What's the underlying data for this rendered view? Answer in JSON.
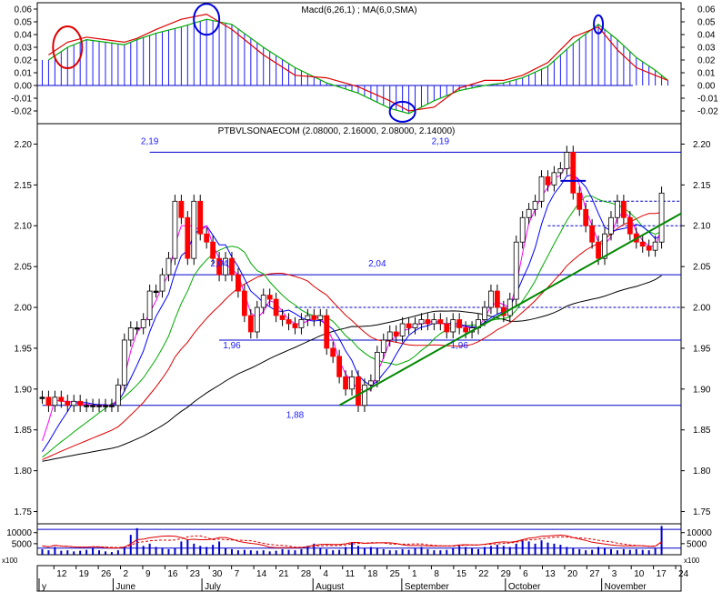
{
  "chart_data": [
    {
      "panel": "macd",
      "type": "line",
      "title": "Macd(6,26,1) ; MA(6,0,SMA)",
      "ylim": [
        -0.03,
        0.065
      ],
      "yticks": [
        "0.06",
        "0.05",
        "0.04",
        "0.03",
        "0.02",
        "0.01",
        "0.00",
        "-0.01",
        "-0.02"
      ],
      "series": [
        {
          "x": [
            1,
            4,
            7,
            10,
            13,
            15,
            18,
            22,
            26,
            30,
            35,
            40,
            45,
            50,
            55,
            58,
            62,
            66,
            70,
            73,
            76,
            80,
            84,
            88,
            91,
            94,
            97,
            99
          ],
          "values": [
            0.02,
            0.03,
            0.036,
            0.034,
            0.032,
            0.036,
            0.041,
            0.046,
            0.052,
            0.048,
            0.03,
            0.014,
            0.002,
            -0.006,
            -0.018,
            -0.022,
            -0.012,
            -0.004,
            0.0,
            0.002,
            0.006,
            0.015,
            0.033,
            0.048,
            0.036,
            0.022,
            0.012,
            0.004
          ]
        },
        {
          "x": [
            1,
            4,
            7,
            10,
            13,
            15,
            18,
            22,
            26,
            30,
            35,
            40,
            45,
            50,
            55,
            58,
            62,
            66,
            70,
            73,
            76,
            80,
            84,
            88,
            91,
            94,
            97,
            99
          ],
          "values": [
            0.024,
            0.034,
            0.038,
            0.036,
            0.034,
            0.037,
            0.044,
            0.052,
            0.056,
            0.044,
            0.024,
            0.008,
            0.006,
            -0.001,
            -0.012,
            -0.02,
            -0.017,
            -0.002,
            0.004,
            0.004,
            0.008,
            0.018,
            0.038,
            0.046,
            0.028,
            0.014,
            0.008,
            0.004
          ]
        }
      ],
      "markers": [
        "red",
        "blue",
        "blue",
        "blue"
      ]
    },
    {
      "panel": "price",
      "type": "candlestick",
      "title": "PTBVLSONAECOM (2.08000, 2.16000, 2.08000, 2.14000)",
      "ylim": [
        1.735,
        2.225
      ],
      "yticks": [
        "2.20",
        "2.15",
        "2.10",
        "2.05",
        "2.00",
        "1.95",
        "1.90",
        "1.85",
        "1.80",
        "1.75"
      ],
      "x_range": [
        0,
        104
      ],
      "close": [
        1.89,
        1.88,
        1.89,
        1.885,
        1.88,
        1.885,
        1.88,
        1.88,
        1.88,
        1.88,
        1.88,
        1.88,
        1.905,
        1.96,
        1.975,
        1.975,
        1.985,
        2.02,
        2.02,
        2.04,
        2.06,
        2.13,
        2.11,
        2.06,
        2.13,
        2.09,
        2.08,
        2.06,
        2.04,
        2.06,
        2.04,
        2.02,
        1.99,
        1.97,
        2.0,
        2.015,
        2.01,
        1.99,
        1.985,
        1.98,
        1.975,
        1.985,
        1.99,
        1.985,
        1.99,
        1.95,
        1.94,
        1.915,
        1.9,
        1.915,
        1.88,
        1.905,
        1.91,
        1.945,
        1.96,
        1.97,
        1.965,
        1.98,
        1.975,
        1.98,
        1.985,
        1.98,
        1.985,
        1.98,
        1.97,
        1.985,
        1.975,
        1.97,
        1.975,
        1.985,
        2.0,
        2.02,
        2.0,
        1.99,
        2.01,
        2.08,
        2.11,
        2.12,
        2.13,
        2.16,
        2.15,
        2.165,
        2.17,
        2.19,
        2.14,
        2.12,
        2.1,
        2.08,
        2.06,
        2.09,
        2.11,
        2.13,
        2.11,
        2.09,
        2.08,
        2.075,
        2.07,
        2.08,
        2.14
      ]
    },
    {
      "panel": "volume",
      "type": "bar",
      "yticks": [
        "10000",
        "5000"
      ],
      "unit_label": "x100",
      "ylim": [
        0,
        14000
      ],
      "values": [
        2500,
        2000,
        3500,
        1800,
        2000,
        1500,
        1800,
        2200,
        3000,
        2000,
        1500,
        1200,
        2000,
        3500,
        9000,
        12000,
        4000,
        5000,
        3500,
        3000,
        2500,
        3000,
        6000,
        7000,
        5000,
        4000,
        3500,
        4500,
        6000,
        3000,
        2500,
        2000,
        2200,
        2000,
        1800,
        2000,
        1500,
        1800,
        2500,
        2200,
        2000,
        2500,
        4000,
        5000,
        3000,
        2500,
        2000,
        2200,
        3500,
        5500,
        4000,
        3000,
        3500,
        3000,
        2500,
        2000,
        2000,
        2500,
        2200,
        3000,
        3500,
        2500,
        2000,
        2000,
        2200,
        3000,
        4000,
        3500,
        3000,
        2500,
        3500,
        4000,
        4500,
        4000,
        3500,
        5000,
        7000,
        6000,
        5000,
        6500,
        5500,
        5000,
        4500,
        3500,
        3000,
        2500,
        2000,
        2200,
        3500,
        3000,
        2500,
        2000,
        2500,
        2200,
        2500,
        2200,
        2000,
        3000,
        13000
      ]
    }
  ],
  "price_levels": {
    "solid": [
      {
        "value": 2.19
      },
      {
        "value": 2.04
      },
      {
        "value": 1.96
      },
      {
        "value": 1.88
      }
    ],
    "dashed": [
      {
        "value": 2.13
      },
      {
        "value": 2.1
      },
      {
        "value": 2.0
      }
    ]
  },
  "level_labels": [
    {
      "text": "2,19",
      "x": 17,
      "y": 2.2
    },
    {
      "text": "2,04",
      "x": 28,
      "y": 2.05
    },
    {
      "text": "1,96",
      "x": 30,
      "y": 1.95
    },
    {
      "text": "1,88",
      "x": 40,
      "y": 1.865
    },
    {
      "text": "2,04",
      "x": 53,
      "y": 2.05
    },
    {
      "text": "2,19",
      "x": 63,
      "y": 2.2
    },
    {
      "text": "1,96",
      "x": 66,
      "y": 1.95
    }
  ],
  "x_axis": {
    "days": [
      {
        "label": "12",
        "x": 2
      },
      {
        "label": "19",
        "x": 5
      },
      {
        "label": "26",
        "x": 8
      },
      {
        "label": "2",
        "x": 11
      },
      {
        "label": "9",
        "x": 14
      },
      {
        "label": "16",
        "x": 17
      },
      {
        "label": "23",
        "x": 20
      },
      {
        "label": "30",
        "x": 23
      },
      {
        "label": "7",
        "x": 26
      },
      {
        "label": "14",
        "x": 29
      },
      {
        "label": "21",
        "x": 32
      },
      {
        "label": "28",
        "x": 35
      },
      {
        "label": "4",
        "x": 38
      },
      {
        "label": "11",
        "x": 41
      },
      {
        "label": "18",
        "x": 44
      },
      {
        "label": "25",
        "x": 47
      },
      {
        "label": "1",
        "x": 50
      },
      {
        "label": "8",
        "x": 53
      },
      {
        "label": "15",
        "x": 56
      },
      {
        "label": "22",
        "x": 59
      },
      {
        "label": "29",
        "x": 62
      },
      {
        "label": "6",
        "x": 65
      },
      {
        "label": "13",
        "x": 68
      },
      {
        "label": "20",
        "x": 71
      },
      {
        "label": "27",
        "x": 74
      },
      {
        "label": "3",
        "x": 77
      },
      {
        "label": "10",
        "x": 80
      },
      {
        "label": "17",
        "x": 83
      },
      {
        "label": "24",
        "x": 86
      }
    ],
    "months": [
      {
        "label": "y",
        "x": 0
      },
      {
        "label": "June",
        "x": 10
      },
      {
        "label": "July",
        "x": 22
      },
      {
        "label": "August",
        "x": 37
      },
      {
        "label": "September",
        "x": 49
      },
      {
        "label": "October",
        "x": 63
      },
      {
        "label": "November",
        "x": 76
      }
    ]
  },
  "colors": {
    "up": "#ffffff",
    "down": "#ff0000",
    "neutral": "#000000",
    "frame": "#0000cc",
    "ma_red": "#dd0000",
    "ma_green": "#00aa00",
    "ma_blue": "#0000ff",
    "ma_magenta": "#ff00ff",
    "ma_black": "#000000",
    "trendline": "#008800",
    "marker_red": "#dd0000",
    "marker_blue": "#0000dd"
  }
}
